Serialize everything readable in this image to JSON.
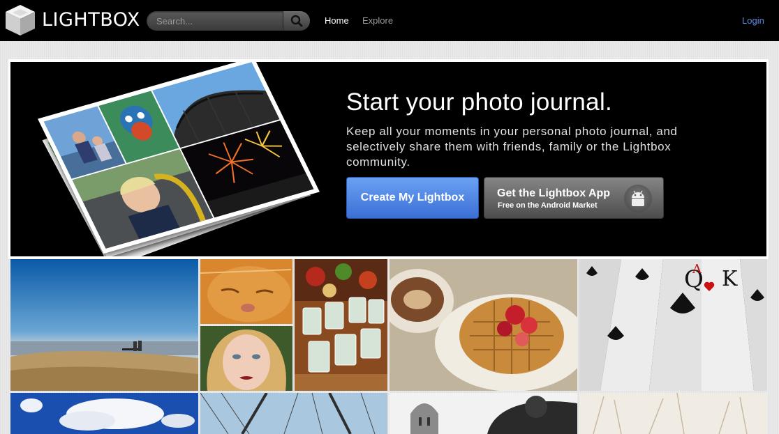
{
  "brand": {
    "name": "LIGHTBOX",
    "logo_icon": "lightbox-cube-icon"
  },
  "search": {
    "placeholder": "Search...",
    "button_icon": "search-icon"
  },
  "nav": {
    "home": "Home",
    "explore": "Explore",
    "login": "Login"
  },
  "hero": {
    "title": "Start your photo journal.",
    "description": "Keep all your moments in your personal photo journal, and selectively share them with friends, family or the Lightbox community.",
    "create_button": "Create My Lightbox",
    "app_button": {
      "title": "Get the Lightbox App",
      "subtitle": "Free on the Android Market",
      "icon": "android-icon"
    }
  },
  "colors": {
    "topbar": "#000000",
    "create_button": "#4a7fe0",
    "app_button": "#6a6a6a",
    "login_link": "#5d8be0"
  },
  "photos": [
    {
      "subject": "hilltop-sky"
    },
    {
      "subject": "orange-cat"
    },
    {
      "subject": "girl-portrait"
    },
    {
      "subject": "drinks-table"
    },
    {
      "subject": "waffle-coffee"
    },
    {
      "subject": "playing-cards"
    },
    {
      "subject": "clouds-sky"
    },
    {
      "subject": "bridge-cables"
    },
    {
      "subject": "dome-trees"
    },
    {
      "subject": "pale-grass"
    }
  ]
}
